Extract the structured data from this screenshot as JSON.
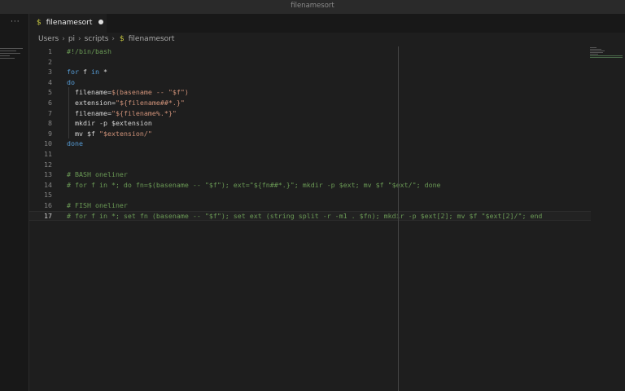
{
  "window": {
    "title": "filenamesort"
  },
  "sidebar": {
    "more_label": "···"
  },
  "tab": {
    "icon": "dollar-icon",
    "label": "filenamesort",
    "dirty": true
  },
  "breadcrumb": [
    "Users",
    "pi",
    "scripts",
    "filenamesort"
  ],
  "editor": {
    "lines": [
      [
        [
          "c",
          "#!/bin/bash"
        ]
      ],
      [],
      [
        [
          "k",
          "for"
        ],
        [
          "t",
          " f "
        ],
        [
          "k",
          "in"
        ],
        [
          "t",
          " *"
        ]
      ],
      [
        [
          "k",
          "do"
        ]
      ],
      [
        [
          "t",
          "  filename="
        ],
        [
          "s",
          "$(basename -- \"$f\")"
        ]
      ],
      [
        [
          "t",
          "  extension="
        ],
        [
          "s",
          "\"${filename##*.}\""
        ]
      ],
      [
        [
          "t",
          "  filename="
        ],
        [
          "s",
          "\"${filename%.*}\""
        ]
      ],
      [
        [
          "t",
          "  mkdir -p $extension"
        ]
      ],
      [
        [
          "t",
          "  mv $f "
        ],
        [
          "s",
          "\"$extension/\""
        ]
      ],
      [
        [
          "k",
          "done"
        ]
      ],
      [],
      [],
      [
        [
          "c",
          "# BASH oneliner"
        ]
      ],
      [
        [
          "c",
          "# for f in *; do fn=$(basename -- \"$f\"); ext=\"${fn##*.}\"; mkdir -p $ext; mv $f \"$ext/\"; done"
        ]
      ],
      [],
      [
        [
          "c",
          "# FISH oneliner"
        ]
      ],
      [
        [
          "c",
          "# for f in *; set fn (basename -- \"$f\"); set ext (string split -r -m1 . $fn); mkdir -p $ext[2]; mv $f \"$ext[2]/\"; end"
        ]
      ]
    ],
    "current_line": 17
  }
}
